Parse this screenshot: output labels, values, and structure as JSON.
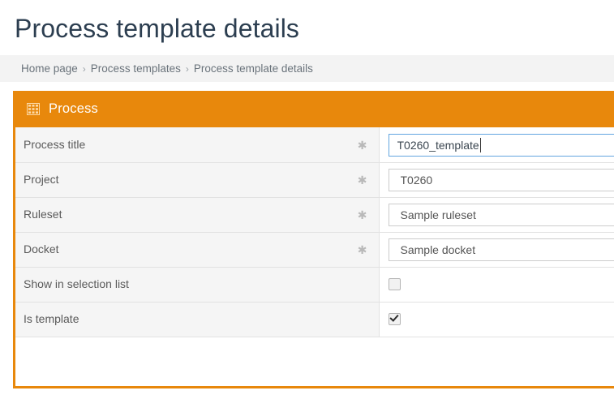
{
  "page": {
    "title": "Process template details"
  },
  "breadcrumb": {
    "separator": "›",
    "items": [
      {
        "label": "Home page"
      },
      {
        "label": "Process templates"
      },
      {
        "label": "Process template details"
      }
    ]
  },
  "panel": {
    "icon": "table-grid-icon",
    "title": "Process",
    "accent_color": "#e8880c",
    "header_text_color": "#ffffff",
    "rows": [
      {
        "label": "Process title",
        "required": true,
        "required_marker": "✱",
        "type": "text",
        "value": "T0260_template",
        "placeholder": "",
        "focused": true
      },
      {
        "label": "Project",
        "required": true,
        "required_marker": "✱",
        "type": "text",
        "value": "T0260",
        "placeholder": "",
        "focused": false
      },
      {
        "label": "Ruleset",
        "required": true,
        "required_marker": "✱",
        "type": "text",
        "value": "Sample ruleset",
        "placeholder": "",
        "focused": false
      },
      {
        "label": "Docket",
        "required": true,
        "required_marker": "✱",
        "type": "text",
        "value": "Sample docket",
        "placeholder": "",
        "focused": false
      },
      {
        "label": "Show in selection list",
        "required": false,
        "required_marker": "",
        "type": "checkbox",
        "checked": false
      },
      {
        "label": "Is template",
        "required": false,
        "required_marker": "",
        "type": "checkbox",
        "checked": true
      }
    ]
  }
}
